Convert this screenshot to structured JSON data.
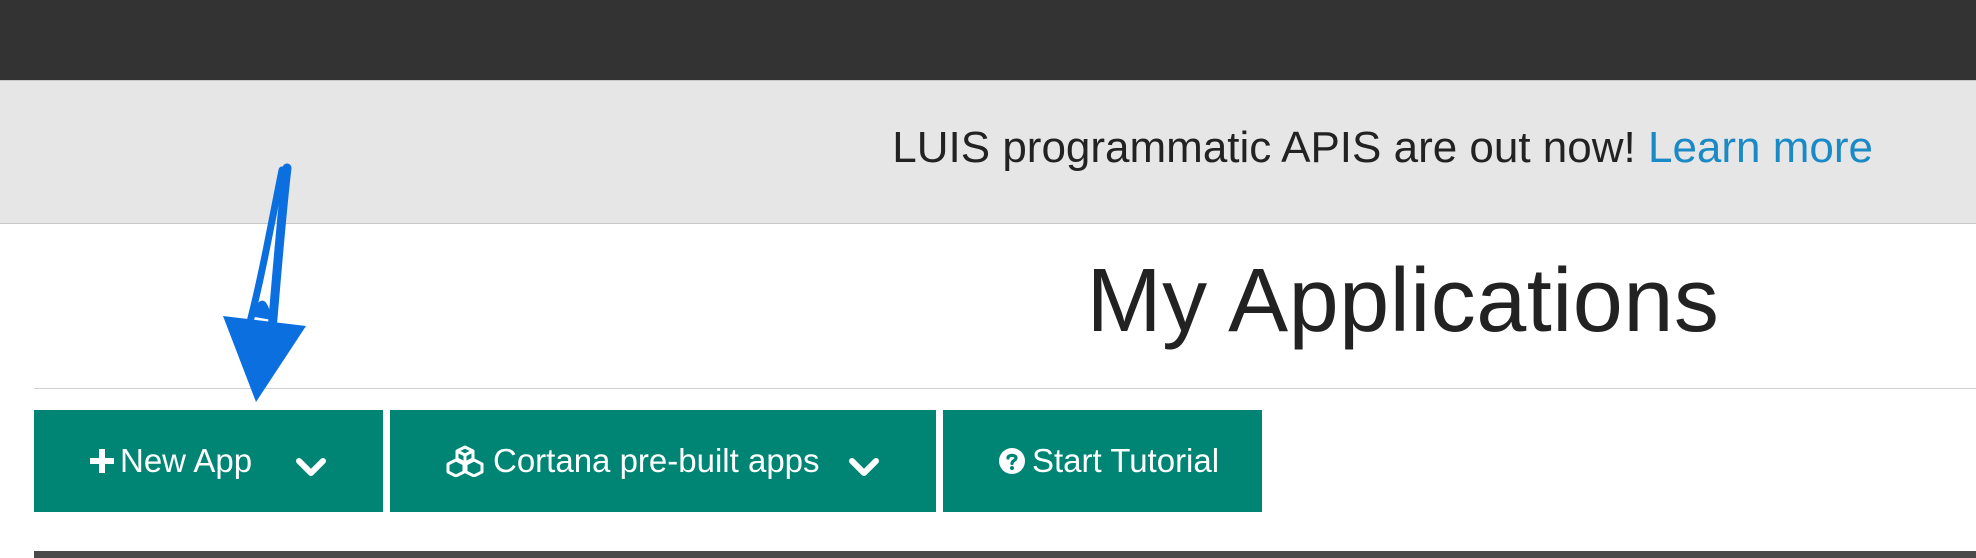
{
  "announcement": {
    "text": "LUIS programmatic APIS are out now!",
    "link_label": "Learn more"
  },
  "page": {
    "title": "My Applications"
  },
  "toolbar": {
    "new_app": {
      "label": "New App",
      "icon": "plus-icon",
      "dropdown_icon": "chevron-down-icon"
    },
    "cortana": {
      "label": "Cortana pre-built apps",
      "icon": "cubes-icon",
      "dropdown_icon": "chevron-down-icon"
    },
    "tutorial": {
      "label": "Start Tutorial",
      "icon": "question-circle-icon"
    }
  },
  "annotation": {
    "icon": "arrow-down-icon"
  },
  "colors": {
    "topbar": "#333333",
    "banner_bg": "#e6e6e6",
    "link": "#1a8ac6",
    "button_bg": "#008575",
    "arrow": "#0b6fe0"
  }
}
